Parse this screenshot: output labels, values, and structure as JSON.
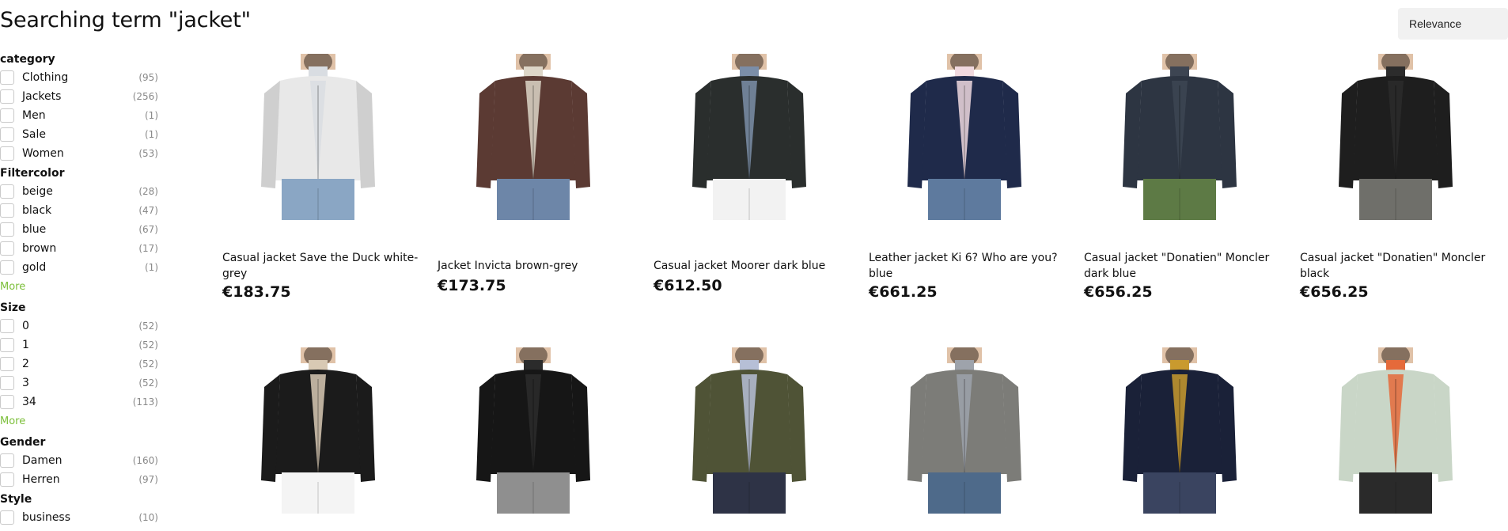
{
  "header": {
    "title": "Searching term \"jacket\"",
    "sort": "Relevance"
  },
  "filters": [
    {
      "title": "category",
      "options": [
        {
          "label": "Clothing",
          "count": "(95)"
        },
        {
          "label": "Jackets",
          "count": "(256)"
        },
        {
          "label": "Men",
          "count": "(1)"
        },
        {
          "label": "Sale",
          "count": "(1)"
        },
        {
          "label": "Women",
          "count": "(53)"
        }
      ]
    },
    {
      "title": "Filtercolor",
      "options": [
        {
          "label": "beige",
          "count": "(28)"
        },
        {
          "label": "black",
          "count": "(47)"
        },
        {
          "label": "blue",
          "count": "(67)"
        },
        {
          "label": "brown",
          "count": "(17)"
        },
        {
          "label": "gold",
          "count": "(1)"
        }
      ],
      "more": "More"
    },
    {
      "title": "Size",
      "options": [
        {
          "label": "0",
          "count": "(52)"
        },
        {
          "label": "1",
          "count": "(52)"
        },
        {
          "label": "2",
          "count": "(52)"
        },
        {
          "label": "3",
          "count": "(52)"
        },
        {
          "label": "34",
          "count": "(113)"
        }
      ],
      "more": "More"
    },
    {
      "title": "Gender",
      "options": [
        {
          "label": "Damen",
          "count": "(160)"
        },
        {
          "label": "Herren",
          "count": "(97)"
        }
      ]
    },
    {
      "title": "Style",
      "options": [
        {
          "label": "business",
          "count": "(10)"
        }
      ]
    }
  ],
  "products": [
    {
      "name": "Casual jacket Save the Duck white-grey",
      "price": "€183.75",
      "jacket": "#e8e8e8",
      "sleeve": "#cfcfcf",
      "pants": "#8aa6c4",
      "inner": "#d9dde2"
    },
    {
      "name": "Jacket Invicta brown-grey",
      "price": "€173.75",
      "jacket": "#5b3a33",
      "sleeve": "#5b3a33",
      "pants": "#6d86a8",
      "inner": "#ddd6c8"
    },
    {
      "name": "Casual jacket Moorer dark blue",
      "price": "€612.50",
      "jacket": "#2a2e2d",
      "sleeve": "#2a2e2d",
      "pants": "#f2f2f2",
      "inner": "#7b8ea8"
    },
    {
      "name": "Leather jacket Ki 6? Who are you? blue",
      "price": "€661.25",
      "jacket": "#1f2a4a",
      "sleeve": "#1f2a4a",
      "pants": "#5e7a9e",
      "inner": "#f0d9df"
    },
    {
      "name": "Casual jacket \"Donatien\" Moncler dark blue",
      "price": "€656.25",
      "jacket": "#2d3542",
      "sleeve": "#2d3542",
      "pants": "#5d7a45",
      "inner": "#3d4552"
    },
    {
      "name": "Casual jacket \"Donatien\" Moncler black",
      "price": "€656.25",
      "jacket": "#1e1e1e",
      "sleeve": "#1e1e1e",
      "pants": "#6f6f6a",
      "inner": "#2c2c2c"
    },
    {
      "name": "",
      "price": "",
      "jacket": "#1b1b1b",
      "sleeve": "#1b1b1b",
      "pants": "#f4f4f4",
      "inner": "#d8c9b4"
    },
    {
      "name": "",
      "price": "",
      "jacket": "#161616",
      "sleeve": "#161616",
      "pants": "#8f8f8f",
      "inner": "#2b2b2b"
    },
    {
      "name": "",
      "price": "",
      "jacket": "#4f5336",
      "sleeve": "#4f5336",
      "pants": "#2e3346",
      "inner": "#b6bfd6"
    },
    {
      "name": "",
      "price": "",
      "jacket": "#7c7c78",
      "sleeve": "#7c7c78",
      "pants": "#4e6a8a",
      "inner": "#9ea3ab"
    },
    {
      "name": "",
      "price": "",
      "jacket": "#1a2138",
      "sleeve": "#1a2138",
      "pants": "#3a4460",
      "inner": "#c99a2e"
    },
    {
      "name": "",
      "price": "",
      "jacket": "#c9d6c7",
      "sleeve": "#c9d6c7",
      "pants": "#2a2a2a",
      "inner": "#e56a3a"
    }
  ]
}
